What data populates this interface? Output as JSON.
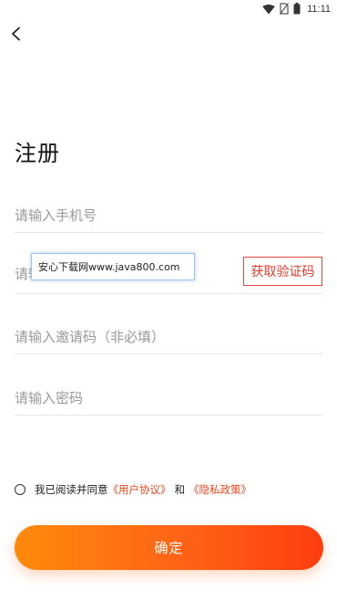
{
  "status_bar": {
    "time": "11:11",
    "icons": [
      "wifi-icon",
      "sim-off-icon",
      "battery-icon"
    ]
  },
  "header": {
    "back_icon": "chevron-left-icon"
  },
  "page": {
    "title": "注册"
  },
  "form": {
    "phone_placeholder": "请输入手机号",
    "code_placeholder": "请输入验证码",
    "get_code_label": "获取验证码",
    "invite_placeholder": "请输入邀请码（非必填）",
    "password_placeholder": "请输入密码"
  },
  "watermark": {
    "text": "安心下载网www.java800.com"
  },
  "agreement": {
    "prefix": "我已阅读并同意",
    "user_agreement": "《用户协议》",
    "and": "和",
    "privacy_policy": "《隐私政策》"
  },
  "submit": {
    "label": "确定"
  },
  "colors": {
    "accent": "#e8481c",
    "button_gradient_start": "#ff8a0c",
    "button_gradient_end": "#ff3d0f",
    "code_button_border": "#e64a3b"
  }
}
